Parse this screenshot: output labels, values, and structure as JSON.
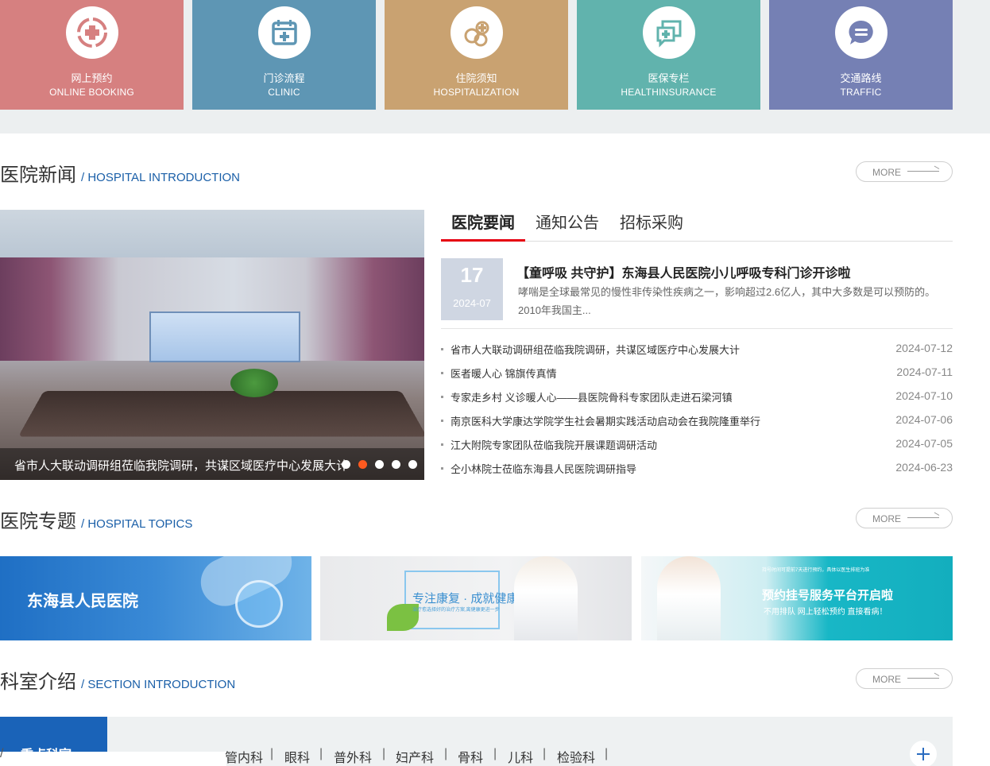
{
  "quick_links": [
    {
      "cn": "网上预约",
      "en": "ONLINE BOOKING",
      "icon": "medical-cross-circle-icon",
      "color": "#d68080"
    },
    {
      "cn": "门诊流程",
      "en": "CLINIC",
      "icon": "calendar-plus-icon",
      "color": "#5e96b4"
    },
    {
      "cn": "住院须知",
      "en": "HOSPITALIZATION",
      "icon": "hospital-cross-icon",
      "color": "#c9a271"
    },
    {
      "cn": "医保专栏",
      "en": "HEALTHINSURANCE",
      "icon": "chat-cross-icon",
      "color": "#61b3ad"
    },
    {
      "cn": "交通路线",
      "en": "TRAFFIC",
      "icon": "speech-bubble-icon",
      "color": "#7580b4"
    }
  ],
  "sections": {
    "news": {
      "cn": "医院新闻",
      "en": "/ HOSPITAL INTRODUCTION",
      "more": "MORE"
    },
    "topics": {
      "cn": "医院专题",
      "en": "/ HOSPITAL TOPICS",
      "more": "MORE"
    },
    "depts": {
      "cn": "科室介绍",
      "en": "/ SECTION INTRODUCTION",
      "more": "MORE"
    }
  },
  "slider": {
    "caption": "省市人大联动调研组莅临我院调研，共谋区域医疗中心发展大计",
    "active_dot": 1,
    "dot_count": 5
  },
  "news_tabs": [
    "医院要闻",
    "通知公告",
    "招标采购"
  ],
  "featured": {
    "day": "17",
    "ym": "2024-07",
    "title": "【童呼吸 共守护】东海县人民医院小儿呼吸专科门诊开诊啦",
    "summary": "哮喘是全球最常见的慢性非传染性疾病之一，影响超过2.6亿人，其中大多数是可以预防的。2010年我国主..."
  },
  "news_list": [
    {
      "title": "省市人大联动调研组莅临我院调研，共谋区域医疗中心发展大计",
      "date": "2024-07-12"
    },
    {
      "title": "医者暖人心 锦旗传真情",
      "date": "2024-07-11"
    },
    {
      "title": "专家走乡村 义诊暖人心——县医院骨科专家团队走进石梁河镇",
      "date": "2024-07-10"
    },
    {
      "title": "南京医科大学康达学院学生社会暑期实践活动启动会在我院隆重举行",
      "date": "2024-07-06"
    },
    {
      "title": "江大附院专家团队莅临我院开展课题调研活动",
      "date": "2024-07-05"
    },
    {
      "title": "仝小林院士莅临东海县人民医院调研指导",
      "date": "2024-06-23"
    }
  ],
  "banners": {
    "b1": {
      "title": "东海县人民医院"
    },
    "b2": {
      "title": "专注康复 · 成就健康",
      "sub": "治疗愈选择好的治疗方案,离健康更进一步"
    },
    "b3": {
      "top": "持号时间可提前7天进行预约，具体以医生排班为准",
      "title": "预约挂号服务平台开启啦",
      "sub": "不用排队 网上轻松预约 直接看病！"
    }
  },
  "departments": {
    "featured": "重点科室",
    "cut_text": "/",
    "items": [
      "管内科",
      "眼科",
      "普外科",
      "妇产科",
      "骨科",
      "儿科",
      "检验科"
    ]
  }
}
